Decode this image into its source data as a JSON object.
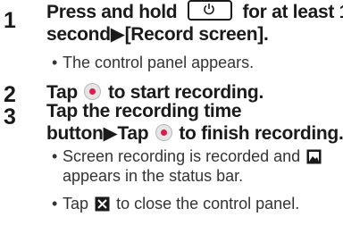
{
  "steps": [
    {
      "number": "1",
      "title_line1_a": "Press and hold",
      "title_line1_b": "for at least 1",
      "title_line2": "second▶[Record screen].",
      "bullets": [
        "The control panel appears."
      ]
    },
    {
      "number": "2",
      "title_a": "Tap",
      "title_b": "to start recording."
    },
    {
      "number": "3",
      "title_line1": "Tap the recording time",
      "title_line2_a": "button▶Tap",
      "title_line2_b": "to finish recording.",
      "bullet1_line1_a": "Screen recording is recorded and",
      "bullet1_line2": "appears in the status bar.",
      "bullet2_a": "Tap",
      "bullet2_b": "to close the control panel."
    }
  ],
  "bullet_char": "•",
  "icons": {
    "power_key": "power-key-icon",
    "record": "record-button-icon",
    "stop": "stop-button-icon",
    "screenshot": "image-notification-icon",
    "close": "close-x-icon"
  }
}
